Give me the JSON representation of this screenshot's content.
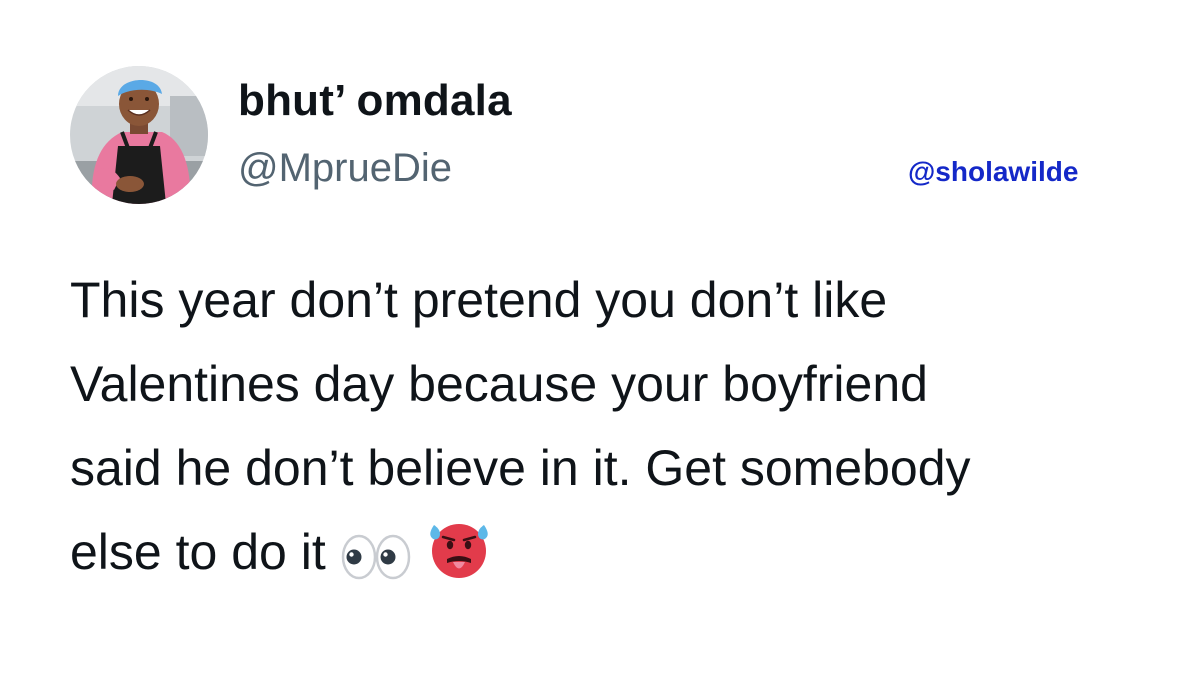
{
  "tweet": {
    "author": {
      "display_name": "bhut’ omdala",
      "handle": "@MprueDie",
      "avatar_icon": "profile-photo-avatar"
    },
    "text_lines": [
      "This year don’t pretend you don’t like",
      "Valentines day because your boyfriend",
      "said he don’t believe in it. Get somebody",
      "else to do it"
    ],
    "emojis": [
      "eyes-emoji",
      "hot-face-emoji"
    ]
  },
  "watermark": {
    "text": "@sholawilde",
    "color": "#1428c8"
  },
  "colors": {
    "text_primary": "#0f1419",
    "text_secondary": "#536471",
    "background": "#ffffff"
  }
}
